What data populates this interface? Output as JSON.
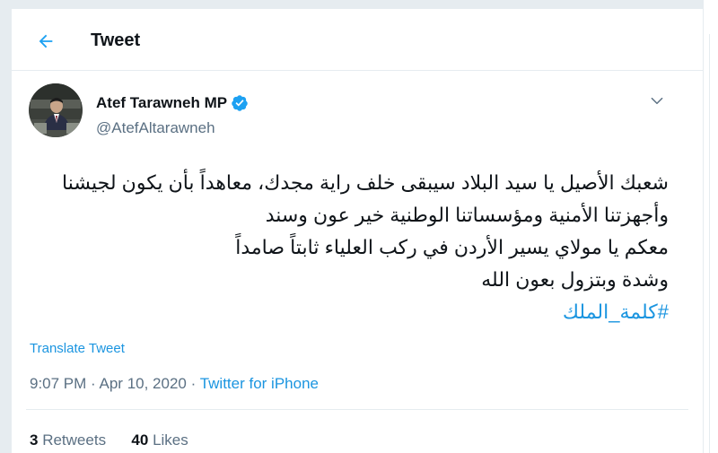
{
  "header": {
    "title": "Tweet",
    "back_icon": "back-arrow-icon"
  },
  "author": {
    "name": "Atef Tarawneh MP",
    "handle": "@AtefAltarawneh",
    "verified_icon": "verified-badge-icon"
  },
  "tweet": {
    "lines": [
      "شعبك الأصيل يا سيد البلاد سيبقى خلف راية مجدك، معاهداً بأن يكون لجيشنا",
      "وأجهزتنا الأمنية ومؤسساتنا الوطنية خير عون وسند",
      "معكم يا مولاي يسير الأردن في ركب العلياء ثابتاً صامداً",
      "وشدة وبتزول بعون الله"
    ],
    "hashtag": "#كلمة_الملك",
    "translate_label": "Translate Tweet",
    "time": "9:07 PM",
    "date": "Apr 10, 2020",
    "separator": "·",
    "source": "Twitter for iPhone"
  },
  "stats": {
    "retweets_count": "3",
    "retweets_label": "Retweets",
    "likes_count": "40",
    "likes_label": "Likes"
  },
  "colors": {
    "accent": "#1b95e0",
    "secondary_text": "#5b7083",
    "primary_text": "#0f1419",
    "border": "#e6ecf0",
    "verified": "#1da1f2"
  }
}
